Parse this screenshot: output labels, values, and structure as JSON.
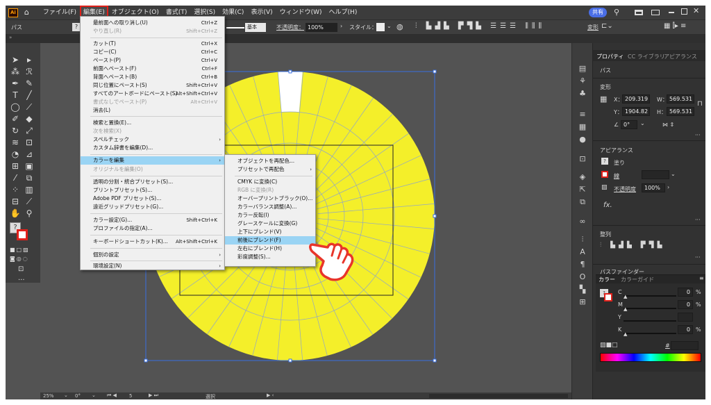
{
  "app": {
    "logo": "Ai"
  },
  "menubar": {
    "items": [
      "ファイル(F)",
      "編集(E)",
      "オブジェクト(O)",
      "書式(T)",
      "選択(S)",
      "効果(C)",
      "表示(V)",
      "ウィンドウ(W)",
      "ヘルプ(H)"
    ],
    "active_index": 1,
    "share_label": "共有"
  },
  "control_bar": {
    "selection_label": "パス",
    "stroke_preset": "基本",
    "opacity_label": "不透明度：",
    "opacity_value": "100%",
    "style_label": "スタイル：",
    "transform_label": "変形"
  },
  "edit_menu": {
    "items": [
      {
        "label": "最前面への取り消し(U)",
        "shortcut": "Ctrl+Z",
        "disabled": false
      },
      {
        "label": "やり直し(R)",
        "shortcut": "Shift+Ctrl+Z",
        "disabled": true
      },
      {
        "label": "カット(T)",
        "shortcut": "Ctrl+X",
        "disabled": false
      },
      {
        "label": "コピー(C)",
        "shortcut": "Ctrl+C",
        "disabled": false
      },
      {
        "label": "ペースト(P)",
        "shortcut": "Ctrl+V",
        "disabled": false
      },
      {
        "label": "前面へペースト(F)",
        "shortcut": "Ctrl+F",
        "disabled": false
      },
      {
        "label": "背面へペースト(B)",
        "shortcut": "Ctrl+B",
        "disabled": false
      },
      {
        "label": "同じ位置にペースト(S)",
        "shortcut": "Shift+Ctrl+V",
        "disabled": false
      },
      {
        "label": "すべてのアートボードにペースト(S)",
        "shortcut": "Alt+Shift+Ctrl+V",
        "disabled": false
      },
      {
        "label": "書式なしでペースト(P)",
        "shortcut": "Alt+Ctrl+V",
        "disabled": true
      },
      {
        "label": "消去(L)",
        "shortcut": "",
        "disabled": false
      },
      {
        "label": "検索と置換(E)...",
        "shortcut": "",
        "disabled": false
      },
      {
        "label": "次を検索(X)",
        "shortcut": "",
        "disabled": true
      },
      {
        "label": "スペルチェック",
        "shortcut": "",
        "disabled": false
      },
      {
        "label": "カスタム辞書を編集(D)...",
        "shortcut": "",
        "disabled": false
      },
      {
        "label": "カラーを編集",
        "shortcut": "",
        "disabled": false
      },
      {
        "label": "オリジナルを編集(O)",
        "shortcut": "",
        "disabled": true
      },
      {
        "label": "透明の分割・統合プリセット(S)...",
        "shortcut": "",
        "disabled": false
      },
      {
        "label": "プリントプリセット(S)...",
        "shortcut": "",
        "disabled": false
      },
      {
        "label": "Adobe PDF プリセット(S)...",
        "shortcut": "",
        "disabled": false
      },
      {
        "label": "遠近グリッドプリセット(G)...",
        "shortcut": "",
        "disabled": false
      },
      {
        "label": "カラー設定(G)...",
        "shortcut": "Shift+Ctrl+K",
        "disabled": false
      },
      {
        "label": "プロファイルの指定(A)...",
        "shortcut": "",
        "disabled": false
      },
      {
        "label": "キーボードショートカット(K)...",
        "shortcut": "Alt+Shift+Ctrl+K",
        "disabled": false
      },
      {
        "label": "個別の設定",
        "shortcut": "",
        "disabled": false
      },
      {
        "label": "環境設定(N)",
        "shortcut": "",
        "disabled": false
      }
    ]
  },
  "color_submenu": {
    "items": [
      {
        "label": "オブジェクトを再配色...",
        "disabled": false
      },
      {
        "label": "プリセットで再配色",
        "disabled": false
      },
      {
        "label": "CMYK に変換(C)",
        "disabled": false
      },
      {
        "label": "RGB に変換(R)",
        "disabled": true
      },
      {
        "label": "オーバープリントブラック(O)...",
        "disabled": false
      },
      {
        "label": "カラーバランス調整(A)...",
        "disabled": false
      },
      {
        "label": "カラー反転(I)",
        "disabled": false
      },
      {
        "label": "グレースケールに変換(G)",
        "disabled": false
      },
      {
        "label": "上下にブレンド(V)",
        "disabled": false
      },
      {
        "label": "前後にブレンド(F)",
        "disabled": false
      },
      {
        "label": "左右にブレンド(H)",
        "disabled": false
      },
      {
        "label": "彩度調整(S)...",
        "disabled": false
      }
    ],
    "highlight_index": 9
  },
  "properties_panel": {
    "tabs": [
      "プロパティ",
      "CC ライブラリ",
      "アピアランス"
    ],
    "object_type": "パス",
    "transform_label": "変形",
    "x_label": "X：",
    "x_value": "209.319",
    "y_label": "Y：",
    "y_value": "1904.82",
    "w_label": "W：",
    "w_value": "569.531",
    "h_label": "H：",
    "h_value": "569.531",
    "angle_value": "0°",
    "appearance_label": "アピアランス",
    "fill_label": "塗り",
    "stroke_label": "線",
    "opacity_label": "不透明度",
    "opacity_value": "100%",
    "fx_label": "fx.",
    "align_label": "整列",
    "pathfinder_label": "パスファインダー"
  },
  "color_panel": {
    "tabs": [
      "カラー",
      "カラーガイド"
    ],
    "channels": [
      {
        "label": "C",
        "value": "0",
        "unit": "%"
      },
      {
        "label": "M",
        "value": "0",
        "unit": "%"
      },
      {
        "label": "Y",
        "value": "",
        "unit": ""
      },
      {
        "label": "K",
        "value": "0",
        "unit": "%"
      }
    ],
    "hex_prefix": "#"
  },
  "status_bar": {
    "zoom": "25%",
    "rotation": "0°",
    "artboard": "5",
    "mode": "選択"
  },
  "colors": {
    "fill_yellow": "#f4ef2a",
    "highlight": "#9ad4f4",
    "active_outline": "#e0201a",
    "pointer": "#e8352a"
  },
  "icons": [
    "home-icon",
    "search-icon",
    "arrange-icon",
    "minimize-icon",
    "maximize-icon",
    "close-icon",
    "pointing-hand-icon"
  ]
}
